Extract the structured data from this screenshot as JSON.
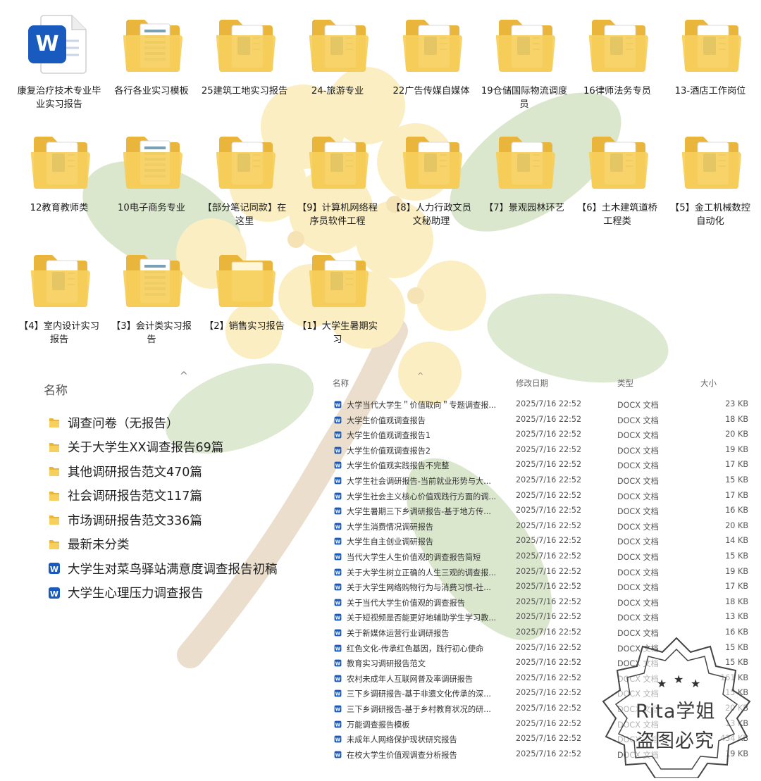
{
  "icons": [
    {
      "label": "康复治疗技术专业毕业实习报告",
      "kind": "word-doc"
    },
    {
      "label": "各行各业实习模板",
      "kind": "folder-sheets"
    },
    {
      "label": "25建筑工地实习报告",
      "kind": "folder-word"
    },
    {
      "label": "24-旅游专业",
      "kind": "folder-word"
    },
    {
      "label": "22广告传媒自媒体",
      "kind": "folder-word"
    },
    {
      "label": "19仓储国际物流调度员",
      "kind": "folder-word"
    },
    {
      "label": "16律师法务专员",
      "kind": "folder-word"
    },
    {
      "label": "13-酒店工作岗位",
      "kind": "folder-word"
    },
    {
      "label": "12教育教师类",
      "kind": "folder-word"
    },
    {
      "label": "10电子商务专业",
      "kind": "folder-sheets"
    },
    {
      "label": "【部分笔记同款】在这里",
      "kind": "folder-word"
    },
    {
      "label": "【9】计算机网络程序员软件工程",
      "kind": "folder-word"
    },
    {
      "label": "【8】人力行政文员文秘助理",
      "kind": "folder-word"
    },
    {
      "label": "【7】景观园林环艺",
      "kind": "folder-word"
    },
    {
      "label": "【6】土木建筑道桥工程类",
      "kind": "folder-word"
    },
    {
      "label": "【5】金工机械数控自动化",
      "kind": "folder-word"
    },
    {
      "label": "【4】室内设计实习报告",
      "kind": "folder-word"
    },
    {
      "label": "【3】会计类实习报告",
      "kind": "folder-sheets"
    },
    {
      "label": "【2】销售实习报告",
      "kind": "folder-plain"
    },
    {
      "label": "【1】大学生暑期实习",
      "kind": "folder-word"
    }
  ],
  "left_list": {
    "header": "名称",
    "items": [
      {
        "name": "调查问卷（无报告）",
        "kind": "folder"
      },
      {
        "name": "关于大学生XX调查报告69篇",
        "kind": "folder"
      },
      {
        "name": "其他调研报告范文470篇",
        "kind": "folder"
      },
      {
        "name": "社会调研报告范文117篇",
        "kind": "folder"
      },
      {
        "name": "市场调研报告范文336篇",
        "kind": "folder"
      },
      {
        "name": "最新未分类",
        "kind": "folder"
      },
      {
        "name": "大学生对菜鸟驿站满意度调查报告初稿",
        "kind": "word"
      },
      {
        "name": "大学生心理压力调查报告",
        "kind": "word"
      }
    ]
  },
  "file_table": {
    "headers": {
      "name": "名称",
      "date": "修改日期",
      "type": "类型",
      "size": "大小"
    },
    "rows": [
      {
        "name": "大学当代大学生＂价值取向＂专题调查报...",
        "date": "2025/7/16 22:52",
        "type": "DOCX 文档",
        "size": "23 KB"
      },
      {
        "name": "大学生价值观调查报告",
        "date": "2025/7/16 22:52",
        "type": "DOCX 文档",
        "size": "18 KB"
      },
      {
        "name": "大学生价值观调查报告1",
        "date": "2025/7/16 22:52",
        "type": "DOCX 文档",
        "size": "20 KB"
      },
      {
        "name": "大学生价值观调查报告2",
        "date": "2025/7/16 22:52",
        "type": "DOCX 文档",
        "size": "19 KB"
      },
      {
        "name": "大学生价值观实践报告不完整",
        "date": "2025/7/16 22:52",
        "type": "DOCX 文档",
        "size": "17 KB"
      },
      {
        "name": "大学生社会调研报告-当前就业形势与大...",
        "date": "2025/7/16 22:52",
        "type": "DOCX 文档",
        "size": "15 KB"
      },
      {
        "name": "大学生社会主义核心价值观践行方面的调...",
        "date": "2025/7/16 22:52",
        "type": "DOCX 文档",
        "size": "17 KB"
      },
      {
        "name": "大学生暑期三下乡调研报告-基于地方传...",
        "date": "2025/7/16 22:52",
        "type": "DOCX 文档",
        "size": "16 KB"
      },
      {
        "name": "大学生消费情况调研报告",
        "date": "2025/7/16 22:52",
        "type": "DOCX 文档",
        "size": "20 KB"
      },
      {
        "name": "大学生自主创业调研报告",
        "date": "2025/7/16 22:52",
        "type": "DOCX 文档",
        "size": "14 KB"
      },
      {
        "name": "当代大学生人生价值观的调查报告简短",
        "date": "2025/7/16 22:52",
        "type": "DOCX 文档",
        "size": "15 KB"
      },
      {
        "name": "关于大学生树立正确的人生三观的调查报...",
        "date": "2025/7/16 22:52",
        "type": "DOCX 文档",
        "size": "19 KB"
      },
      {
        "name": "关于大学生网络购物行为与消费习惯-社...",
        "date": "2025/7/16 22:52",
        "type": "DOCX 文档",
        "size": "17 KB"
      },
      {
        "name": "关于当代大学生价值观的调查报告",
        "date": "2025/7/16 22:52",
        "type": "DOCX 文档",
        "size": "18 KB"
      },
      {
        "name": "关于短视频是否能更好地辅助学生学习教...",
        "date": "2025/7/16 22:52",
        "type": "DOCX 文档",
        "size": "13 KB"
      },
      {
        "name": "关于新媒体运营行业调研报告",
        "date": "2025/7/16 22:52",
        "type": "DOCX 文档",
        "size": "16 KB"
      },
      {
        "name": "红色文化-传承红色基因，践行初心使命",
        "date": "2025/7/16 22:52",
        "type": "DOCX 文档",
        "size": "15 KB"
      },
      {
        "name": "教育实习调研报告范文",
        "date": "2025/7/16 22:52",
        "type": "DOCX 文档",
        "size": "15 KB"
      },
      {
        "name": "农村未成年人互联网普及率调研报告",
        "date": "2025/7/16 22:52",
        "type": "DOCX 文档",
        "size": "161 KB"
      },
      {
        "name": "三下乡调研报告-基于非遗文化传承的深...",
        "date": "2025/7/16 22:52",
        "type": "DOCX 文档",
        "size": "15 KB"
      },
      {
        "name": "三下乡调研报告-基于乡村教育状况的研...",
        "date": "2025/7/16 22:52",
        "type": "DOCX 文档",
        "size": "20 KB"
      },
      {
        "name": "万能调查报告模板",
        "date": "2025/7/16 22:52",
        "type": "DOCX 文档",
        "size": "13 KB"
      },
      {
        "name": "未成年人网络保护现状研究报告",
        "date": "2025/7/16 22:52",
        "type": "DOCX 文档",
        "size": "434 KB"
      },
      {
        "name": "在校大学生价值观调查分析报告",
        "date": "2025/7/16 22:52",
        "type": "DOCX 文档",
        "size": "19 KB"
      }
    ]
  },
  "watermark": {
    "line1": "Rita学姐",
    "line2": "盗图必究"
  },
  "colors": {
    "folder": "#f6cf5c",
    "folder_dark": "#e9b53a",
    "word_blue": "#185abd",
    "word_light": "#41a5ee"
  }
}
